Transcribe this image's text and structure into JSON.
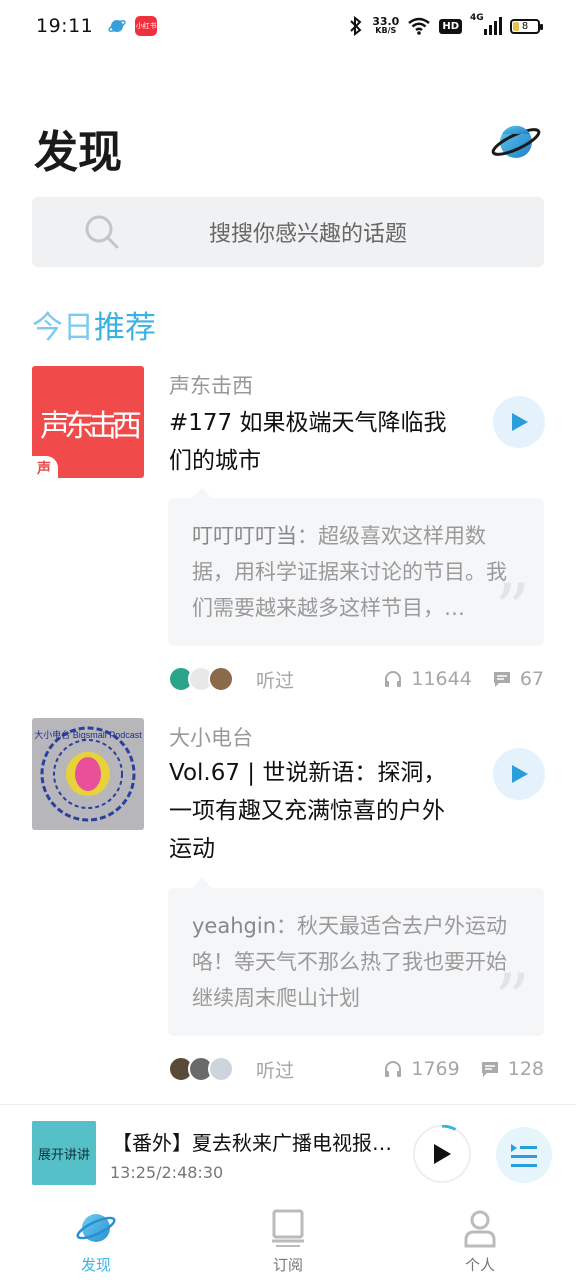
{
  "status_bar": {
    "time": "19:11",
    "app_badge": "小红书",
    "net_speed_value": "33.0",
    "net_speed_unit": "KB/S",
    "hd": "HD",
    "signal": "4G",
    "battery": "8"
  },
  "header": {
    "title": "发现"
  },
  "search": {
    "placeholder": "搜搜你感兴趣的话题"
  },
  "section": {
    "title_part1": "今日",
    "title_part2": "推荐"
  },
  "episodes": [
    {
      "podcast": "声东击西",
      "cover_text": "声东击西",
      "cover_badge": "声",
      "title": "#177 如果极端天气降临我们的城市",
      "comment_user": "叮叮叮叮当",
      "comment_text": "：超级喜欢这样用数据，用科学证据来讨论的节目。我们需要越来越多这样节目，…",
      "listened": "听过",
      "plays": "11644",
      "comments": "67"
    },
    {
      "podcast": "大小电台",
      "cover_text": "大小电台 Bigsmall Podcast",
      "title": "Vol.67 | 世说新语：探洞，一项有趣又充满惊喜的户外运动",
      "comment_user": "yeahgin",
      "comment_text": "：秋天最适合去户外运动咯！等天气不那么热了我也要开始继续周末爬山计划",
      "listened": "听过",
      "plays": "1769",
      "comments": "128"
    }
  ],
  "player": {
    "cover_text": "展开讲讲",
    "title": "【番外】夏去秋来广播电视报…",
    "time": "13:25/2:48:30",
    "progress": 0.08
  },
  "tabbar": {
    "discover": "发现",
    "subscribe": "订阅",
    "profile": "个人"
  },
  "colors": {
    "accent": "#3ab3e4",
    "cover1": "#f04a4a",
    "player_cover": "#55c0c7"
  }
}
